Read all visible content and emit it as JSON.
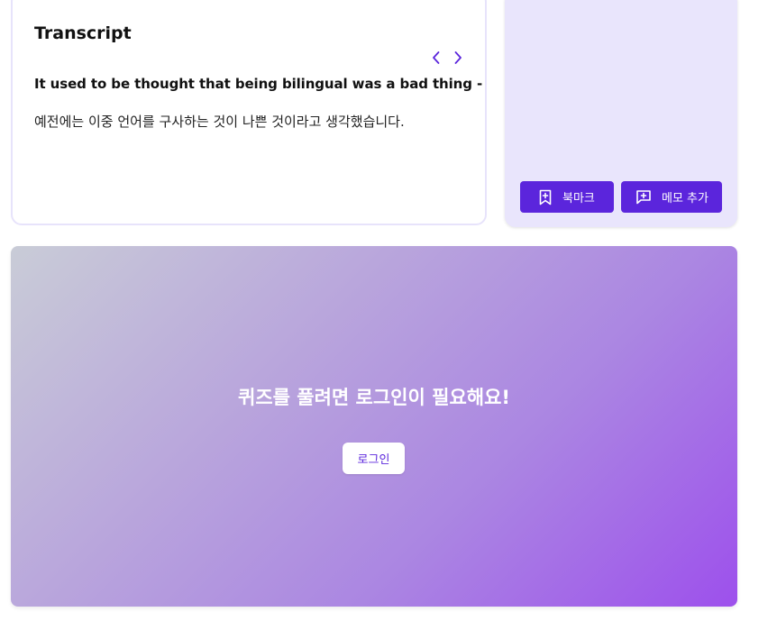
{
  "transcript": {
    "title": "Transcript",
    "sentence_en": "It used to be thought that being bilingual was a bad thing -",
    "sentence_ko": "예전에는 이중 언어를 구사하는 것이 나쁜 것이라고 생각했습니다.",
    "nav": {
      "prev_icon": "chevron-left-icon",
      "next_icon": "chevron-right-icon"
    }
  },
  "side_panel": {
    "bookmark_label": "북마크",
    "bookmark_icon": "bookmark-plus-icon",
    "memo_label": "메모 추가",
    "memo_icon": "message-plus-icon"
  },
  "quiz": {
    "message": "퀴즈를 풀려면 로그인이 필요해요!",
    "login_label": "로그인"
  },
  "colors": {
    "accent": "#5b25dc",
    "panel_bg": "#e9e5fc",
    "gradient_start": "#c9ccd7",
    "gradient_end": "#9d50ec"
  }
}
